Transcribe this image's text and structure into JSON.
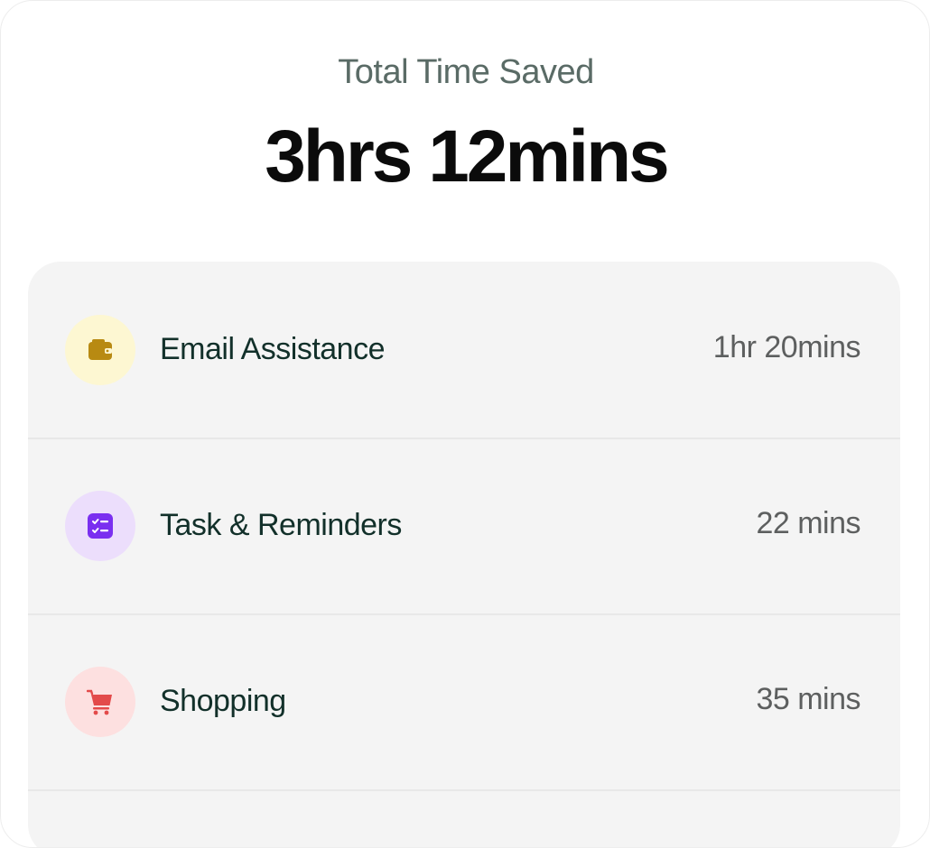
{
  "header": {
    "subtitle": "Total Time Saved",
    "total": "3hrs 12mins"
  },
  "items": [
    {
      "label": "Email Assistance",
      "value": "1hr 20mins",
      "icon": "wallet-icon",
      "icon_color": "#b88a12",
      "bg_color": "#fdf7d2"
    },
    {
      "label": "Task & Reminders",
      "value": "22 mins",
      "icon": "checklist-icon",
      "icon_color": "#7a2ff0",
      "bg_color": "#ecdefc"
    },
    {
      "label": "Shopping",
      "value": "35 mins",
      "icon": "cart-icon",
      "icon_color": "#e34a4a",
      "bg_color": "#fde0e0"
    }
  ]
}
